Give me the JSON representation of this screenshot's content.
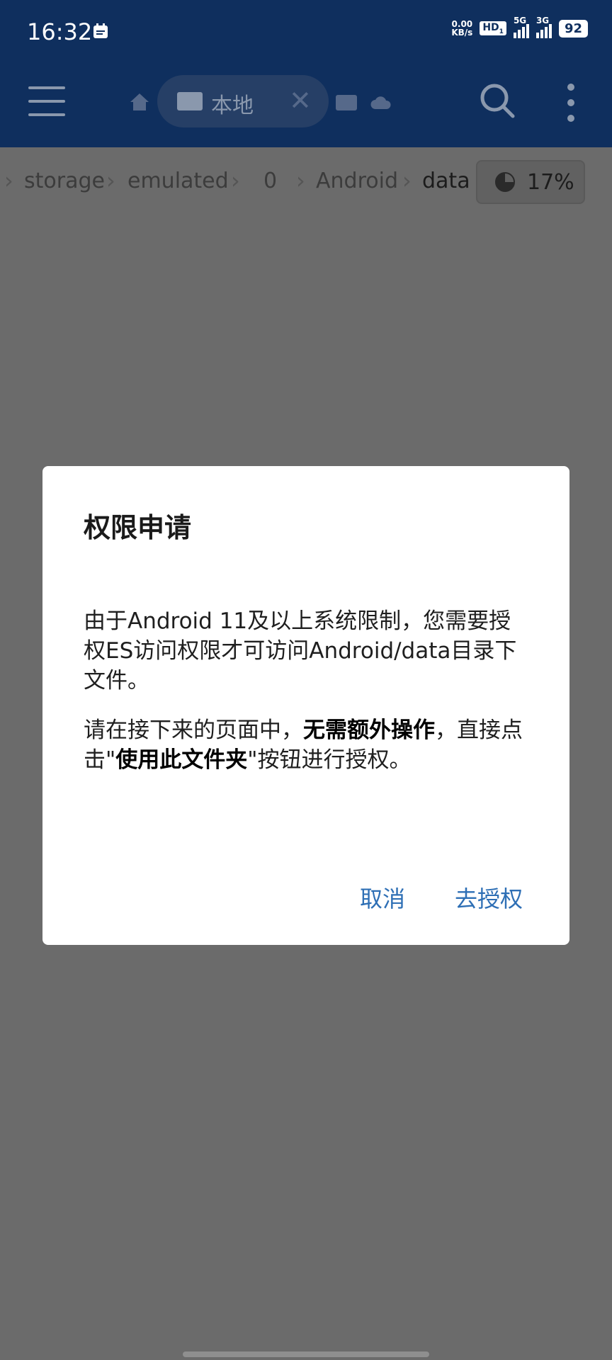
{
  "status_bar": {
    "time": "16:32",
    "net_speed_value": "0.00",
    "net_speed_unit": "KB/s",
    "hd_label": "HD",
    "hd_sub": "1",
    "sig1_label": "5G",
    "sig2_label": "3G",
    "battery": "92"
  },
  "appbar": {
    "tab_label": "本地"
  },
  "breadcrumb": {
    "items": [
      "storage",
      "emulated",
      "0",
      "Android",
      "data"
    ],
    "storage_usage": "17%"
  },
  "dialog": {
    "title": "权限申请",
    "para1": "由于Android 11及以上系统限制，您需要授权ES访问权限才可访问Android/data目录下文件。",
    "para2_pre": "请在接下来的页面中，",
    "para2_bold1": "无需额外操作",
    "para2_mid": "，直接点击\"",
    "para2_bold2": "使用此文件夹",
    "para2_post": "\"按钮进行授权。",
    "cancel_label": "取消",
    "confirm_label": "去授权"
  },
  "colors": {
    "appbar_bg": "#0f2f5e",
    "dialog_button": "#2e6fb5",
    "scrim": "#6b6b6b"
  }
}
